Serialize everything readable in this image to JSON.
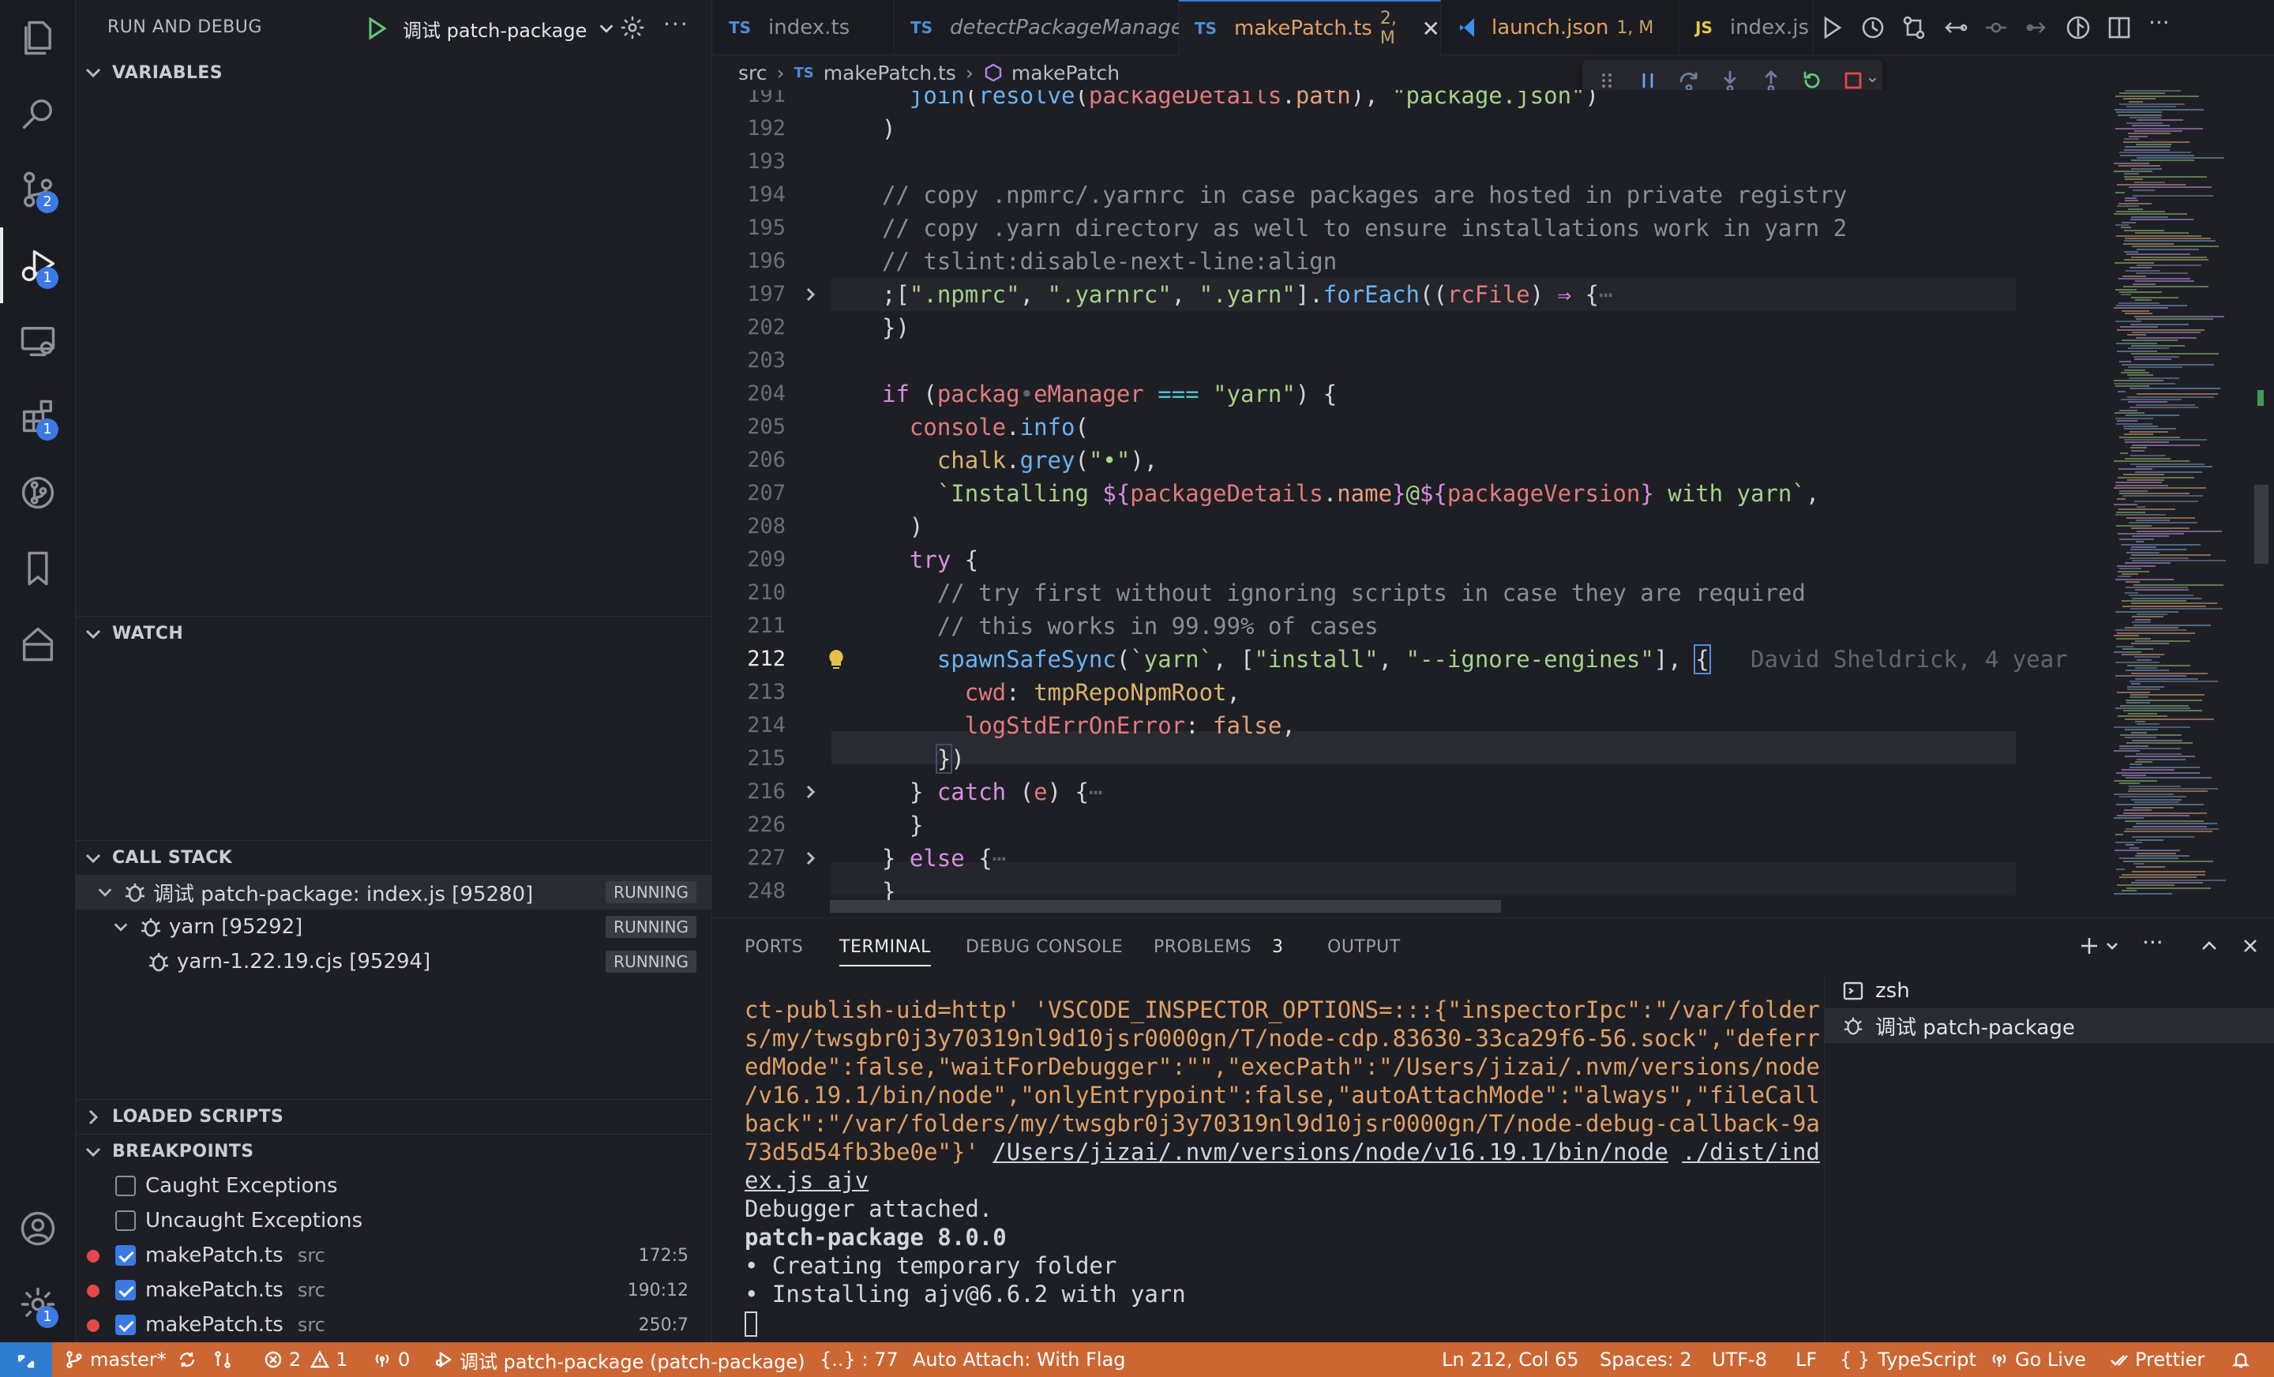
{
  "sidebar": {
    "title": "RUN AND DEBUG",
    "config": "调试 patch-package",
    "variables": "VARIABLES",
    "watch": "WATCH",
    "call_stack": "CALL STACK",
    "stack": [
      {
        "label": "调试 patch-package: index.js [95280]",
        "state": "RUNNING"
      },
      {
        "label": "yarn [95292]",
        "state": "RUNNING"
      },
      {
        "label": "yarn-1.22.19.cjs [95294]",
        "state": "RUNNING"
      }
    ],
    "loaded_scripts": "LOADED SCRIPTS",
    "breakpoints": "BREAKPOINTS",
    "bp_caught": "Caught Exceptions",
    "bp_uncaught": "Uncaught Exceptions",
    "bp_items": [
      {
        "file": "makePatch.ts",
        "src": "src",
        "line": "172:5"
      },
      {
        "file": "makePatch.ts",
        "src": "src",
        "line": "190:12"
      },
      {
        "file": "makePatch.ts",
        "src": "src",
        "line": "250:7"
      }
    ]
  },
  "activity_badges": {
    "scm": "2",
    "debug": "1",
    "extensions": "1",
    "accounts": "1"
  },
  "tabs": [
    {
      "lang": "TS",
      "name": "index.ts",
      "mod": ""
    },
    {
      "lang": "TS",
      "name": "detectPackageManager.ts",
      "mod": ""
    },
    {
      "lang": "TS",
      "name": "makePatch.ts",
      "mod": "2, M"
    },
    {
      "lang": "VS",
      "name": "launch.json",
      "mod": "1, M"
    },
    {
      "lang": "JS",
      "name": "index.js",
      "mod": ""
    }
  ],
  "breadcrumb": {
    "folder": "src",
    "lang": "TS",
    "file": "makePatch.ts",
    "symbol": "makePatch"
  },
  "code": {
    "lines": [
      "191",
      "192",
      "193",
      "194",
      "195",
      "196",
      "197",
      "202",
      "203",
      "204",
      "205",
      "206",
      "207",
      "208",
      "209",
      "210",
      "211",
      "212",
      "213",
      "214",
      "215",
      "216",
      "226",
      "227",
      "248"
    ],
    "current_line": "212",
    "blame": "David Sheldrick, 4 year"
  },
  "panel": {
    "tabs": [
      "PORTS",
      "TERMINAL",
      "DEBUG CONSOLE",
      "PROBLEMS",
      "OUTPUT"
    ],
    "problems_count": "3",
    "terminals": [
      "zsh",
      "调试 patch-package"
    ],
    "output": [
      "ct-publish-uid=http' 'VSCODE_INSPECTOR_OPTIONS=:::{\"inspectorIpc\":\"/var/folder",
      "s/my/twsgbr0j3y70319nl9d10jsr0000gn/T/node-cdp.83630-33ca29f6-56.sock\",\"deferr",
      "edMode\":false,\"waitForDebugger\":\"\",\"execPath\":\"/Users/jizai/.nvm/versions/node",
      "/v16.19.1/bin/node\",\"onlyEntrypoint\":false,\"autoAttachMode\":\"always\",\"fileCall",
      "back\":\"/var/folders/my/twsgbr0j3y70319nl9d10jsr0000gn/T/node-debug-callback-9a",
      "73d5d54fb3be0e\"}'",
      "ex.js ajv",
      "Debugger attached.",
      "patch-package 8.0.0",
      "• Creating temporary folder",
      "• Installing ajv@6.6.2 with yarn"
    ],
    "node_path": "/Users/jizai/.nvm/versions/node/v16.19.1/bin/node",
    "dist_path": "./dist/ind"
  },
  "status": {
    "branch": "master*",
    "errors": "2",
    "warnings": "1",
    "ports": "0",
    "debug": "调试 patch-package (patch-package)",
    "symbol": "{..} : 77",
    "auto_attach": "Auto Attach: With Flag",
    "position": "Ln 212, Col 65",
    "spaces": "Spaces: 2",
    "encoding": "UTF-8",
    "eol": "LF",
    "language": "TypeScript",
    "golive": "Go Live",
    "prettier": "Prettier"
  }
}
